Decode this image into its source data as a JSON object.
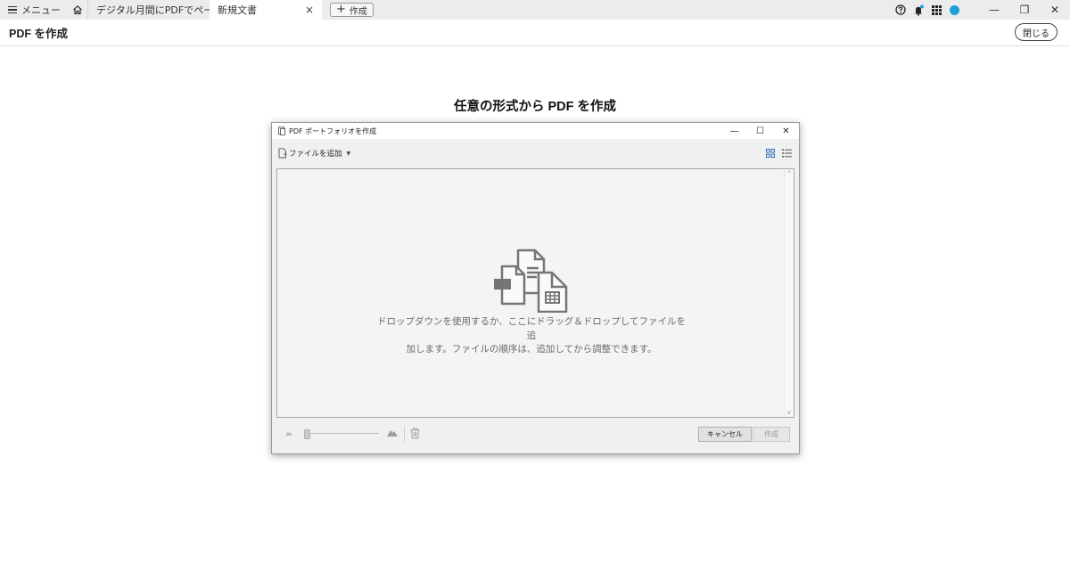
{
  "tabbar": {
    "menu_label": "メニュー",
    "tabs": [
      {
        "label": "デジタル月間にPDFでペーパーレ..."
      },
      {
        "label": "新規文書",
        "close": "×"
      }
    ],
    "new_tab_label": "作成",
    "new_tab_plus": "+",
    "icons": [
      "help-icon",
      "bell-icon",
      "apps-icon",
      "avatar"
    ],
    "window_controls": {
      "minimize": "—",
      "restore": "❐",
      "close": "✕"
    },
    "accent_color": "#1ba3d8"
  },
  "header": {
    "title": "PDF を作成",
    "close_label": "閉じる"
  },
  "main": {
    "heading": "任意の形式から PDF を作成"
  },
  "dialog": {
    "title": "PDF ポートフォリオを作成",
    "controls": {
      "minimize": "—",
      "maximize": "☐",
      "close": "✕"
    },
    "add_file_label": "ファイルを追加",
    "drop_text_line1": "ドロップダウンを使用するか、ここにドラッグ＆ドロップしてファイルを追",
    "drop_text_line2": "加します。ファイルの順序は、追加してから調整できます。",
    "cancel_label": "キャンセル",
    "create_label": "作成",
    "view_icon_color": "#2c6fb5"
  }
}
